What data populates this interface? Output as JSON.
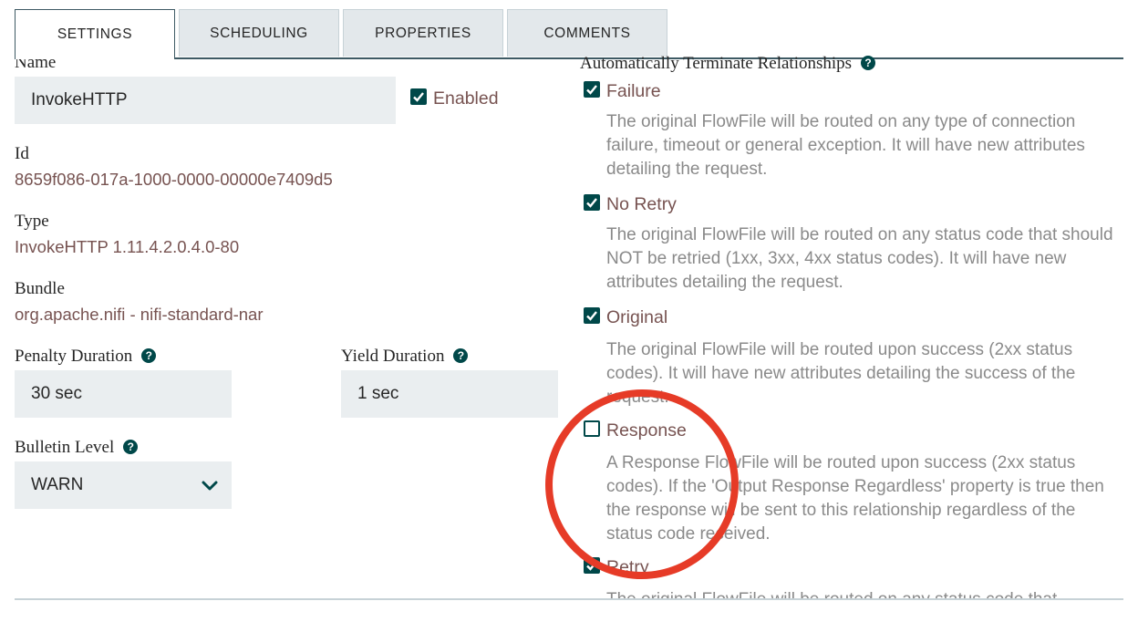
{
  "tabs": [
    {
      "label": "SETTINGS",
      "active": true
    },
    {
      "label": "SCHEDULING",
      "active": false
    },
    {
      "label": "PROPERTIES",
      "active": false
    },
    {
      "label": "COMMENTS",
      "active": false
    }
  ],
  "settings": {
    "name_label": "Name",
    "name_value": "InvokeHTTP",
    "enabled_label": "Enabled",
    "enabled_checked": true,
    "id_label": "Id",
    "id_value": "8659f086-017a-1000-0000-00000e7409d5",
    "type_label": "Type",
    "type_value": "InvokeHTTP 1.11.4.2.0.4.0-80",
    "bundle_label": "Bundle",
    "bundle_value": "org.apache.nifi - nifi-standard-nar",
    "penalty_label": "Penalty Duration",
    "penalty_value": "30 sec",
    "yield_label": "Yield Duration",
    "yield_value": "1 sec",
    "bulletin_label": "Bulletin Level",
    "bulletin_value": "WARN"
  },
  "relationships": {
    "title": "Automatically Terminate Relationships",
    "items": [
      {
        "name": "Failure",
        "checked": true,
        "description": "The original FlowFile will be routed on any type of connection failure, timeout or general exception. It will have new attributes detailing the request."
      },
      {
        "name": "No Retry",
        "checked": true,
        "description": "The original FlowFile will be routed on any status code that should NOT be retried (1xx, 3xx, 4xx status codes). It will have new attributes detailing the request."
      },
      {
        "name": "Original",
        "checked": true,
        "description": "The original FlowFile will be routed upon success (2xx status codes). It will have new attributes detailing the success of the request."
      },
      {
        "name": "Response",
        "checked": false,
        "description": "A Response FlowFile will be routed upon success (2xx status codes). If the 'Output Response Regardless' property is true then the response will be sent to this relationship regardless of the status code received."
      },
      {
        "name": "Retry",
        "checked": true,
        "description": "The original FlowFile will be routed on any status code that"
      }
    ]
  },
  "colors": {
    "accent": "#004849",
    "value_text": "#775351",
    "field_bg": "#eaeef0",
    "annotation": "#e63b27"
  }
}
